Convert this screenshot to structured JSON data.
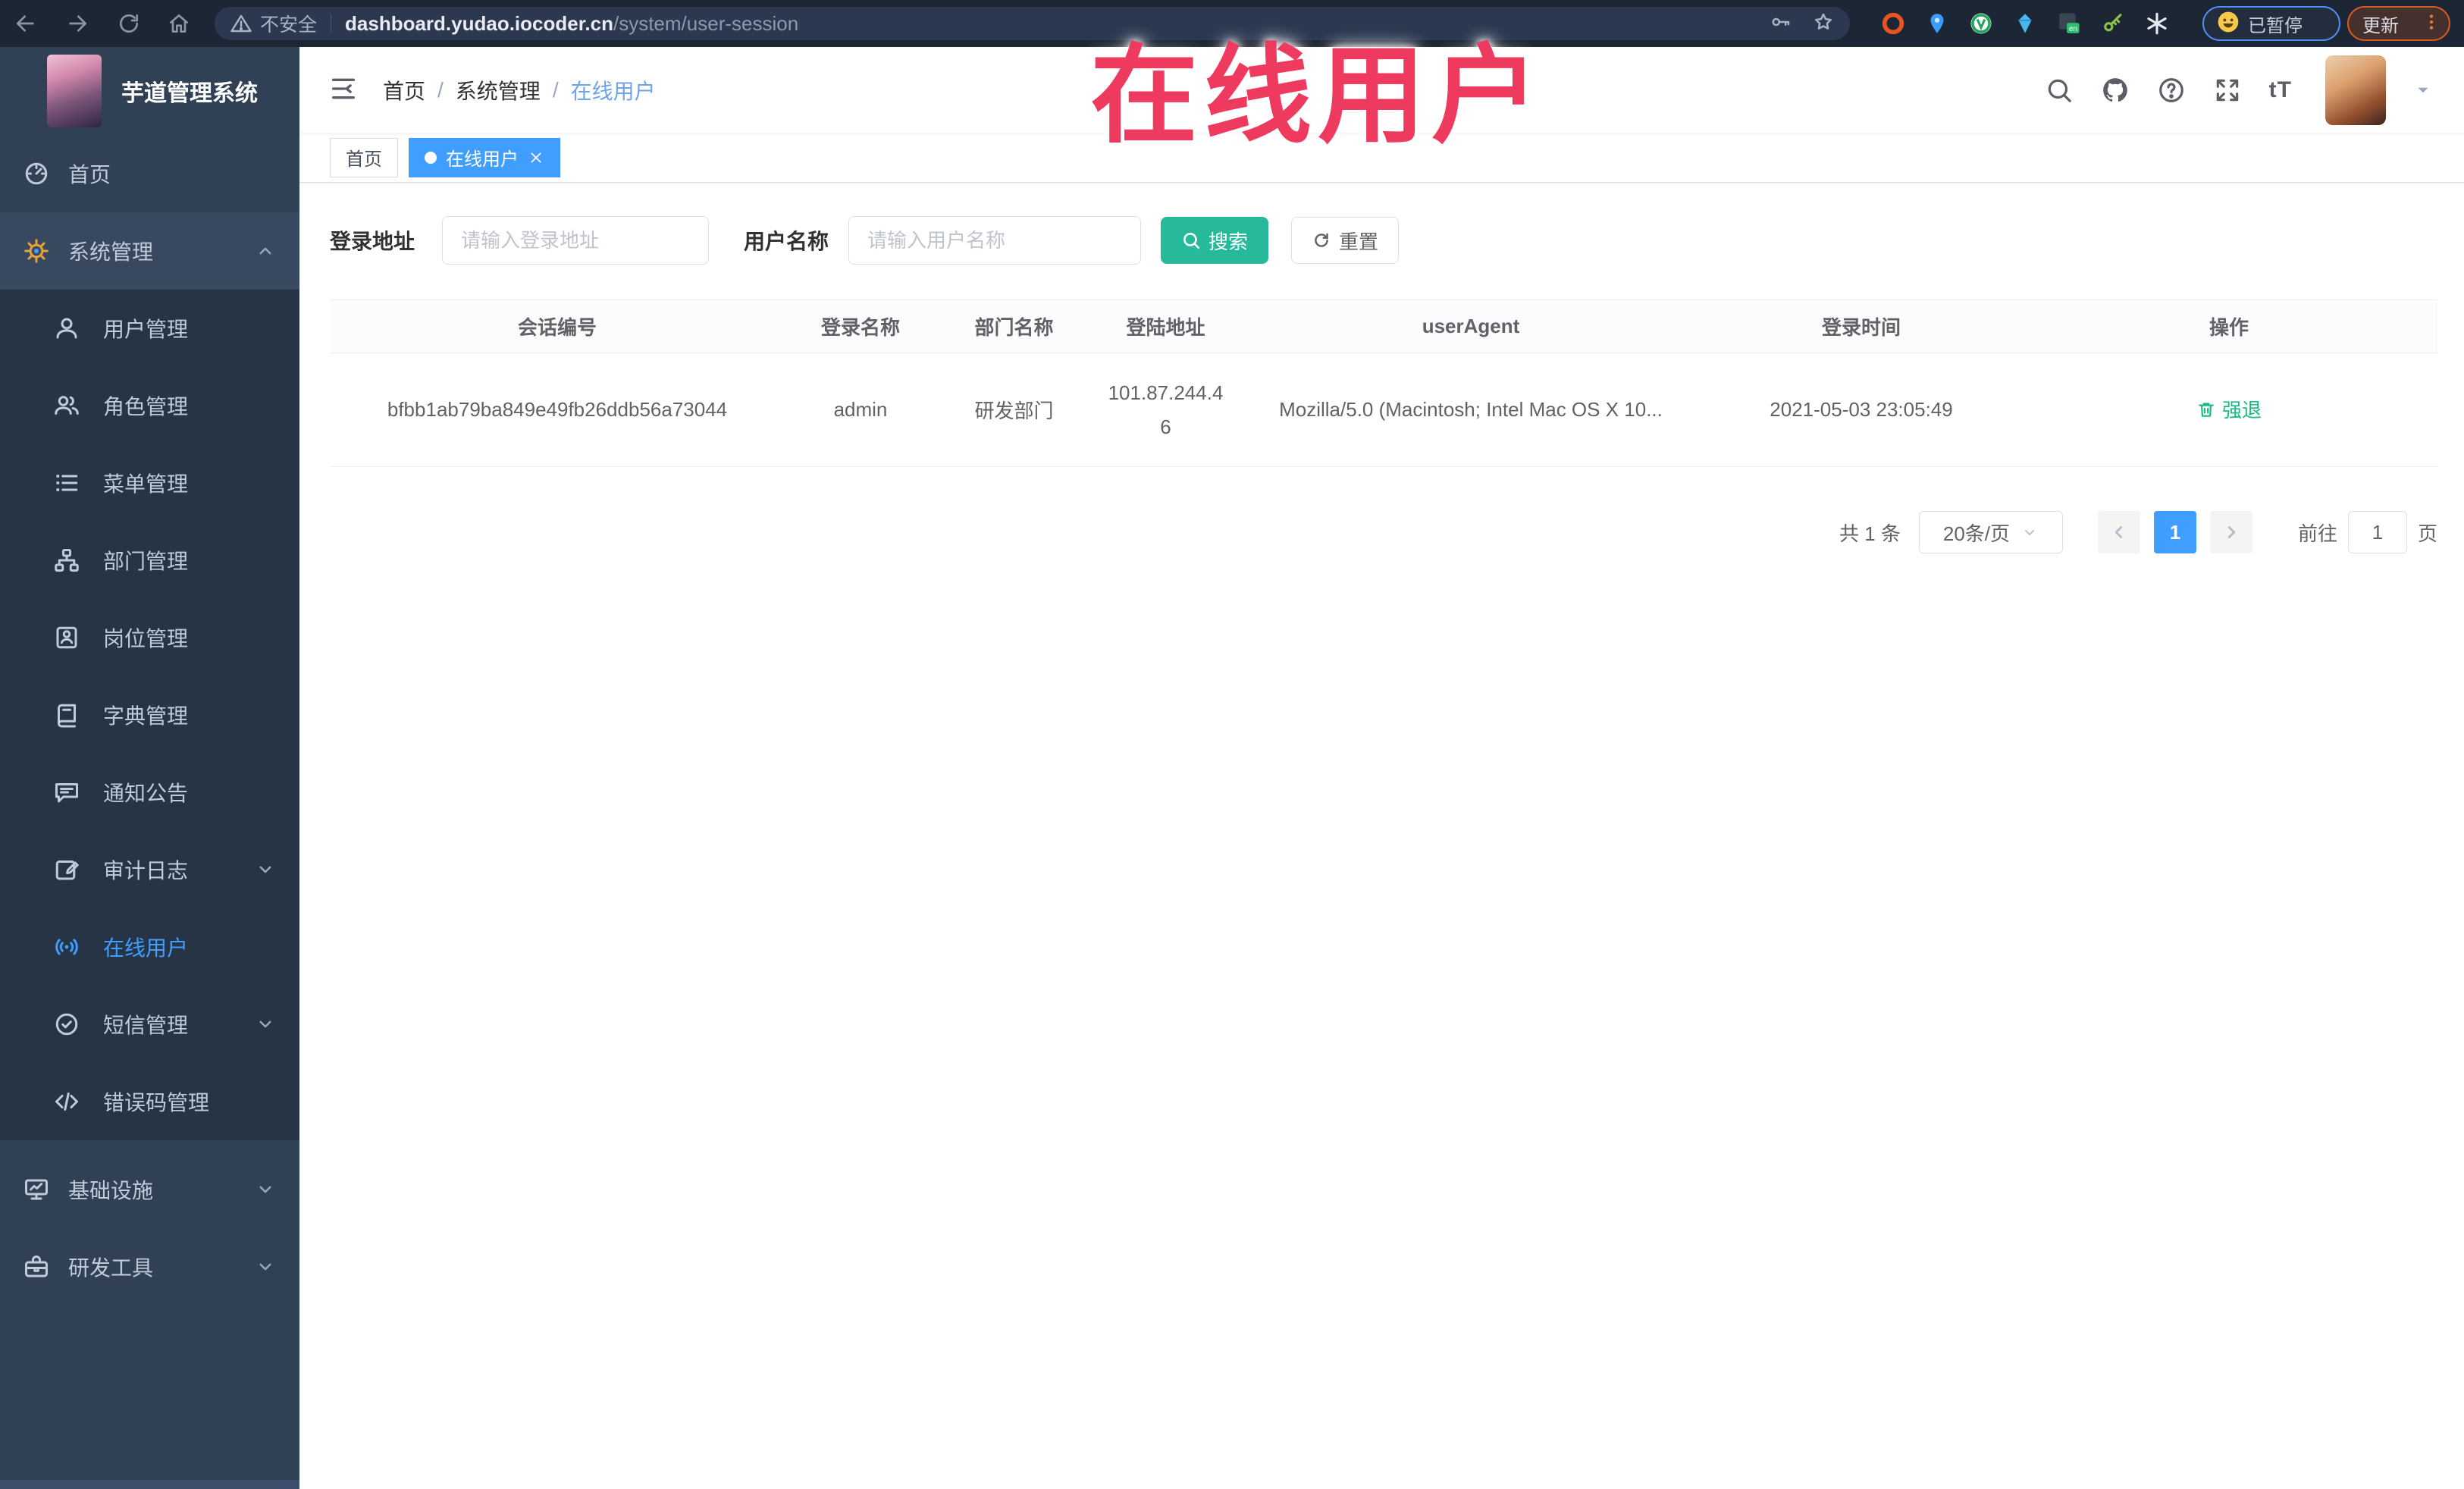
{
  "browser": {
    "security_label": "不安全",
    "url_host": "dashboard.yudao.iocoder.cn",
    "url_path": "/system/user-session",
    "profile_chip_label": "已暂停",
    "update_button_label": "更新",
    "extensions": [
      {
        "icon": "orange-ring-extension-icon"
      },
      {
        "icon": "blue-pin-extension-icon"
      },
      {
        "icon": "green-circle-extension-icon"
      },
      {
        "icon": "cyan-gem-extension-icon"
      },
      {
        "icon": "translate-extension-icon"
      },
      {
        "icon": "green-key-extension-icon"
      },
      {
        "icon": "white-asterisk-extension-icon"
      }
    ]
  },
  "annotation": {
    "text": "在线用户",
    "color": "#ef3a5f"
  },
  "sidebar": {
    "app_title": "芋道管理系统",
    "items": [
      {
        "label": "首页",
        "icon": "dashboard-icon",
        "level": "top"
      },
      {
        "label": "系统管理",
        "icon": "gear-icon",
        "level": "top",
        "chevron": "up",
        "open": true
      },
      {
        "label": "用户管理",
        "icon": "user-icon",
        "level": "sub"
      },
      {
        "label": "角色管理",
        "icon": "roles-icon",
        "level": "sub"
      },
      {
        "label": "菜单管理",
        "icon": "menu-tree-icon",
        "level": "sub"
      },
      {
        "label": "部门管理",
        "icon": "org-tree-icon",
        "level": "sub"
      },
      {
        "label": "岗位管理",
        "icon": "badge-icon",
        "level": "sub"
      },
      {
        "label": "字典管理",
        "icon": "dictionary-icon",
        "level": "sub"
      },
      {
        "label": "通知公告",
        "icon": "announcement-icon",
        "level": "sub"
      },
      {
        "label": "审计日志",
        "icon": "audit-log-icon",
        "level": "sub",
        "chevron": "down"
      },
      {
        "label": "在线用户",
        "icon": "online-users-icon",
        "level": "sub",
        "active": true
      },
      {
        "label": "短信管理",
        "icon": "sms-icon",
        "level": "sub",
        "chevron": "down"
      },
      {
        "label": "错误码管理",
        "icon": "error-code-icon",
        "level": "sub"
      },
      {
        "label": "基础设施",
        "icon": "infrastructure-icon",
        "level": "top",
        "chevron": "down",
        "gap": true
      },
      {
        "label": "研发工具",
        "icon": "dev-tools-icon",
        "level": "top",
        "chevron": "down"
      }
    ]
  },
  "header": {
    "breadcrumb": [
      "首页",
      "系统管理",
      "在线用户"
    ]
  },
  "tags": [
    {
      "label": "首页",
      "active": false
    },
    {
      "label": "在线用户",
      "active": true
    }
  ],
  "filters": {
    "login_address_label": "登录地址",
    "login_address_placeholder": "请输入登录地址",
    "username_label": "用户名称",
    "username_placeholder": "请输入用户名称",
    "search_label": "搜索",
    "reset_label": "重置"
  },
  "table": {
    "columns": [
      "会话编号",
      "登录名称",
      "部门名称",
      "登陆地址",
      "userAgent",
      "登录时间",
      "操作"
    ],
    "rows": [
      [
        "bfbb1ab79ba849e49fb26ddb56a73044",
        "admin",
        "研发部门",
        "101.87.244.46",
        "Mozilla/5.0 (Macintosh; Intel Mac OS X 10...",
        "2021-05-03 23:05:49",
        "强退"
      ]
    ]
  },
  "pagination": {
    "total_label": "共 1 条",
    "page_size_label": "20条/页",
    "current_page": "1",
    "goto_label": "前往",
    "goto_value": "1",
    "page_unit": "页"
  }
}
